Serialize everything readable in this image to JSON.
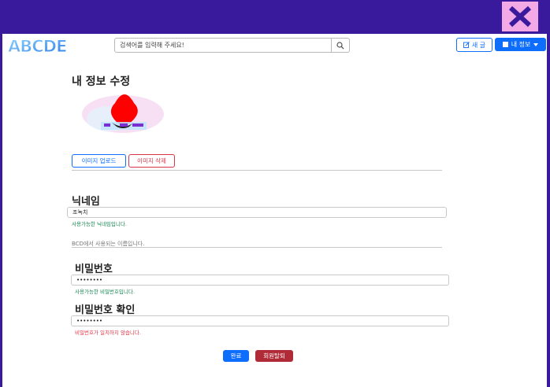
{
  "colors": {
    "frame": "#3a1a9c",
    "close_bg": "#f3a9e6",
    "close_x": "#3a1a9c",
    "primary": "#0d6efd",
    "danger": "#dc3545",
    "success": "#198754"
  },
  "header": {
    "logo_text": "ABCDE",
    "search_placeholder": "검색어를 입력해 주세요!",
    "write_label": "새 글",
    "myinfo_label": "내 정보"
  },
  "profile": {
    "title": "내 정보 수정",
    "upload_label": "이미지 업로드",
    "delete_label": "이미지 삭제"
  },
  "nickname": {
    "label": "닉네임",
    "value": "조녹치",
    "message": "사용가능한 닉네임입니다.",
    "note": "BCD에서 사용되는 이름입니다."
  },
  "password": {
    "label": "비밀번호",
    "value": "••••••••",
    "message": "사용가능한 비밀번호입니다."
  },
  "password_confirm": {
    "label": "비밀번호 확인",
    "value": "••••••••",
    "message": "비밀번호가 일치하지 않습니다."
  },
  "actions": {
    "confirm_label": "완료",
    "withdraw_label": "회원탈퇴"
  }
}
